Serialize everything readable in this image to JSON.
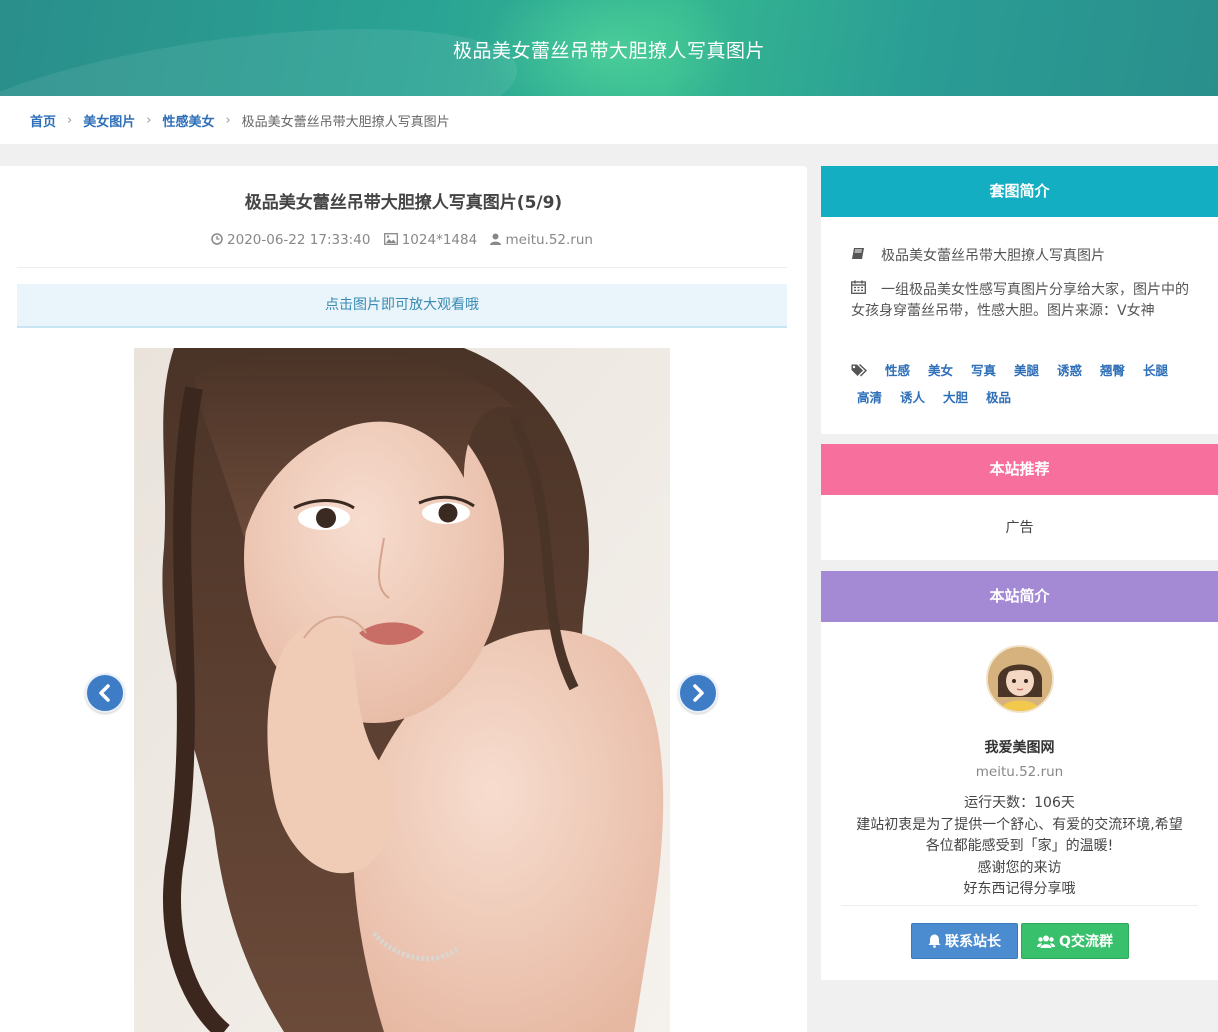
{
  "header": {
    "title": "极品美女蕾丝吊带大胆撩人写真图片"
  },
  "breadcrumb": {
    "items": [
      "首页",
      "美女图片",
      "性感美女"
    ],
    "current": "极品美女蕾丝吊带大胆撩人写真图片",
    "separator": "›"
  },
  "post": {
    "title": "极品美女蕾丝吊带大胆撩人写真图片(5/9)",
    "date": "2020-06-22 17:33:40",
    "dimensions": "1024*1484",
    "source": "meitu.52.run",
    "hint": "点击图片即可放大观看哦"
  },
  "intro_card": {
    "heading": "套图简介",
    "title": "极品美女蕾丝吊带大胆撩人写真图片",
    "description": "一组极品美女性感写真图片分享给大家，图片中的女孩身穿蕾丝吊带，性感大胆。图片来源：V女神",
    "tags": [
      "性感",
      "美女",
      "写真",
      "美腿",
      "诱惑",
      "翘臀",
      "长腿",
      "高清",
      "诱人",
      "大胆",
      "极品"
    ]
  },
  "recommend_card": {
    "heading": "本站推荐",
    "ad": "广告"
  },
  "about_card": {
    "heading": "本站简介",
    "site_name": "我爱美图网",
    "site_url": "meitu.52.run",
    "lines": [
      "运行天数：106天",
      "建站初衷是为了提供一个舒心、有爱的交流环境,希望",
      "各位都能感受到「家」的温暖!",
      "感谢您的来访",
      "好东西记得分享哦"
    ],
    "buttons": {
      "contact": "联系站长",
      "group": "Q交流群"
    }
  },
  "colors": {
    "banner": "#2aa394",
    "link": "#2e6fb8",
    "intro_head": "#14aec3",
    "recommend_head": "#f66f9d",
    "about_head": "#a48ad5",
    "nav_arrow": "#3e7cc6",
    "btn_contact": "#4b8bcf",
    "btn_group": "#39c06c"
  },
  "icons": {
    "meta": [
      "clock-icon",
      "image-icon",
      "user-icon"
    ],
    "intro": [
      "book-icon",
      "calendar-icon",
      "tags-icon"
    ],
    "nav": [
      "chevron-left-icon",
      "chevron-right-icon"
    ],
    "buttons": [
      "bell-icon",
      "group-icon"
    ]
  }
}
